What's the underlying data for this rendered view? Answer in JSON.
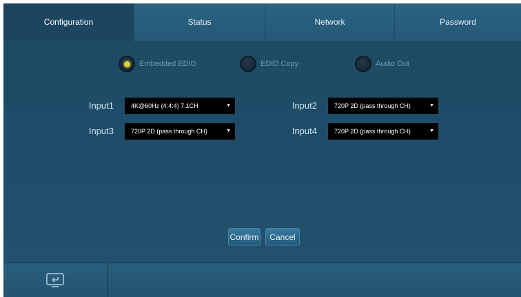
{
  "tabs": [
    {
      "label": "Configuration",
      "active": true
    },
    {
      "label": "Status",
      "active": false
    },
    {
      "label": "Network",
      "active": false
    },
    {
      "label": "Password",
      "active": false
    }
  ],
  "edid_modes": [
    {
      "label": "Embedded EDID",
      "selected": true
    },
    {
      "label": "EDID Copy",
      "selected": false
    },
    {
      "label": "Audio Out",
      "selected": false
    }
  ],
  "inputs": [
    {
      "label": "Input1",
      "value": "4K@60Hz (4:4:4) 7.1CH"
    },
    {
      "label": "Input2",
      "value": "720P 2D (pass through CH)"
    },
    {
      "label": "Input3",
      "value": "720P 2D (pass through CH)"
    },
    {
      "label": "Input4",
      "value": "720P 2D (pass through CH)"
    }
  ],
  "buttons": {
    "confirm": "Confirm",
    "cancel": "Cancel"
  },
  "colors": {
    "accent_radio": "#d8d03a",
    "background": "#1f4d6a"
  },
  "icons": {
    "bottom": "screen-return-icon",
    "caret": "caret-down-icon"
  }
}
